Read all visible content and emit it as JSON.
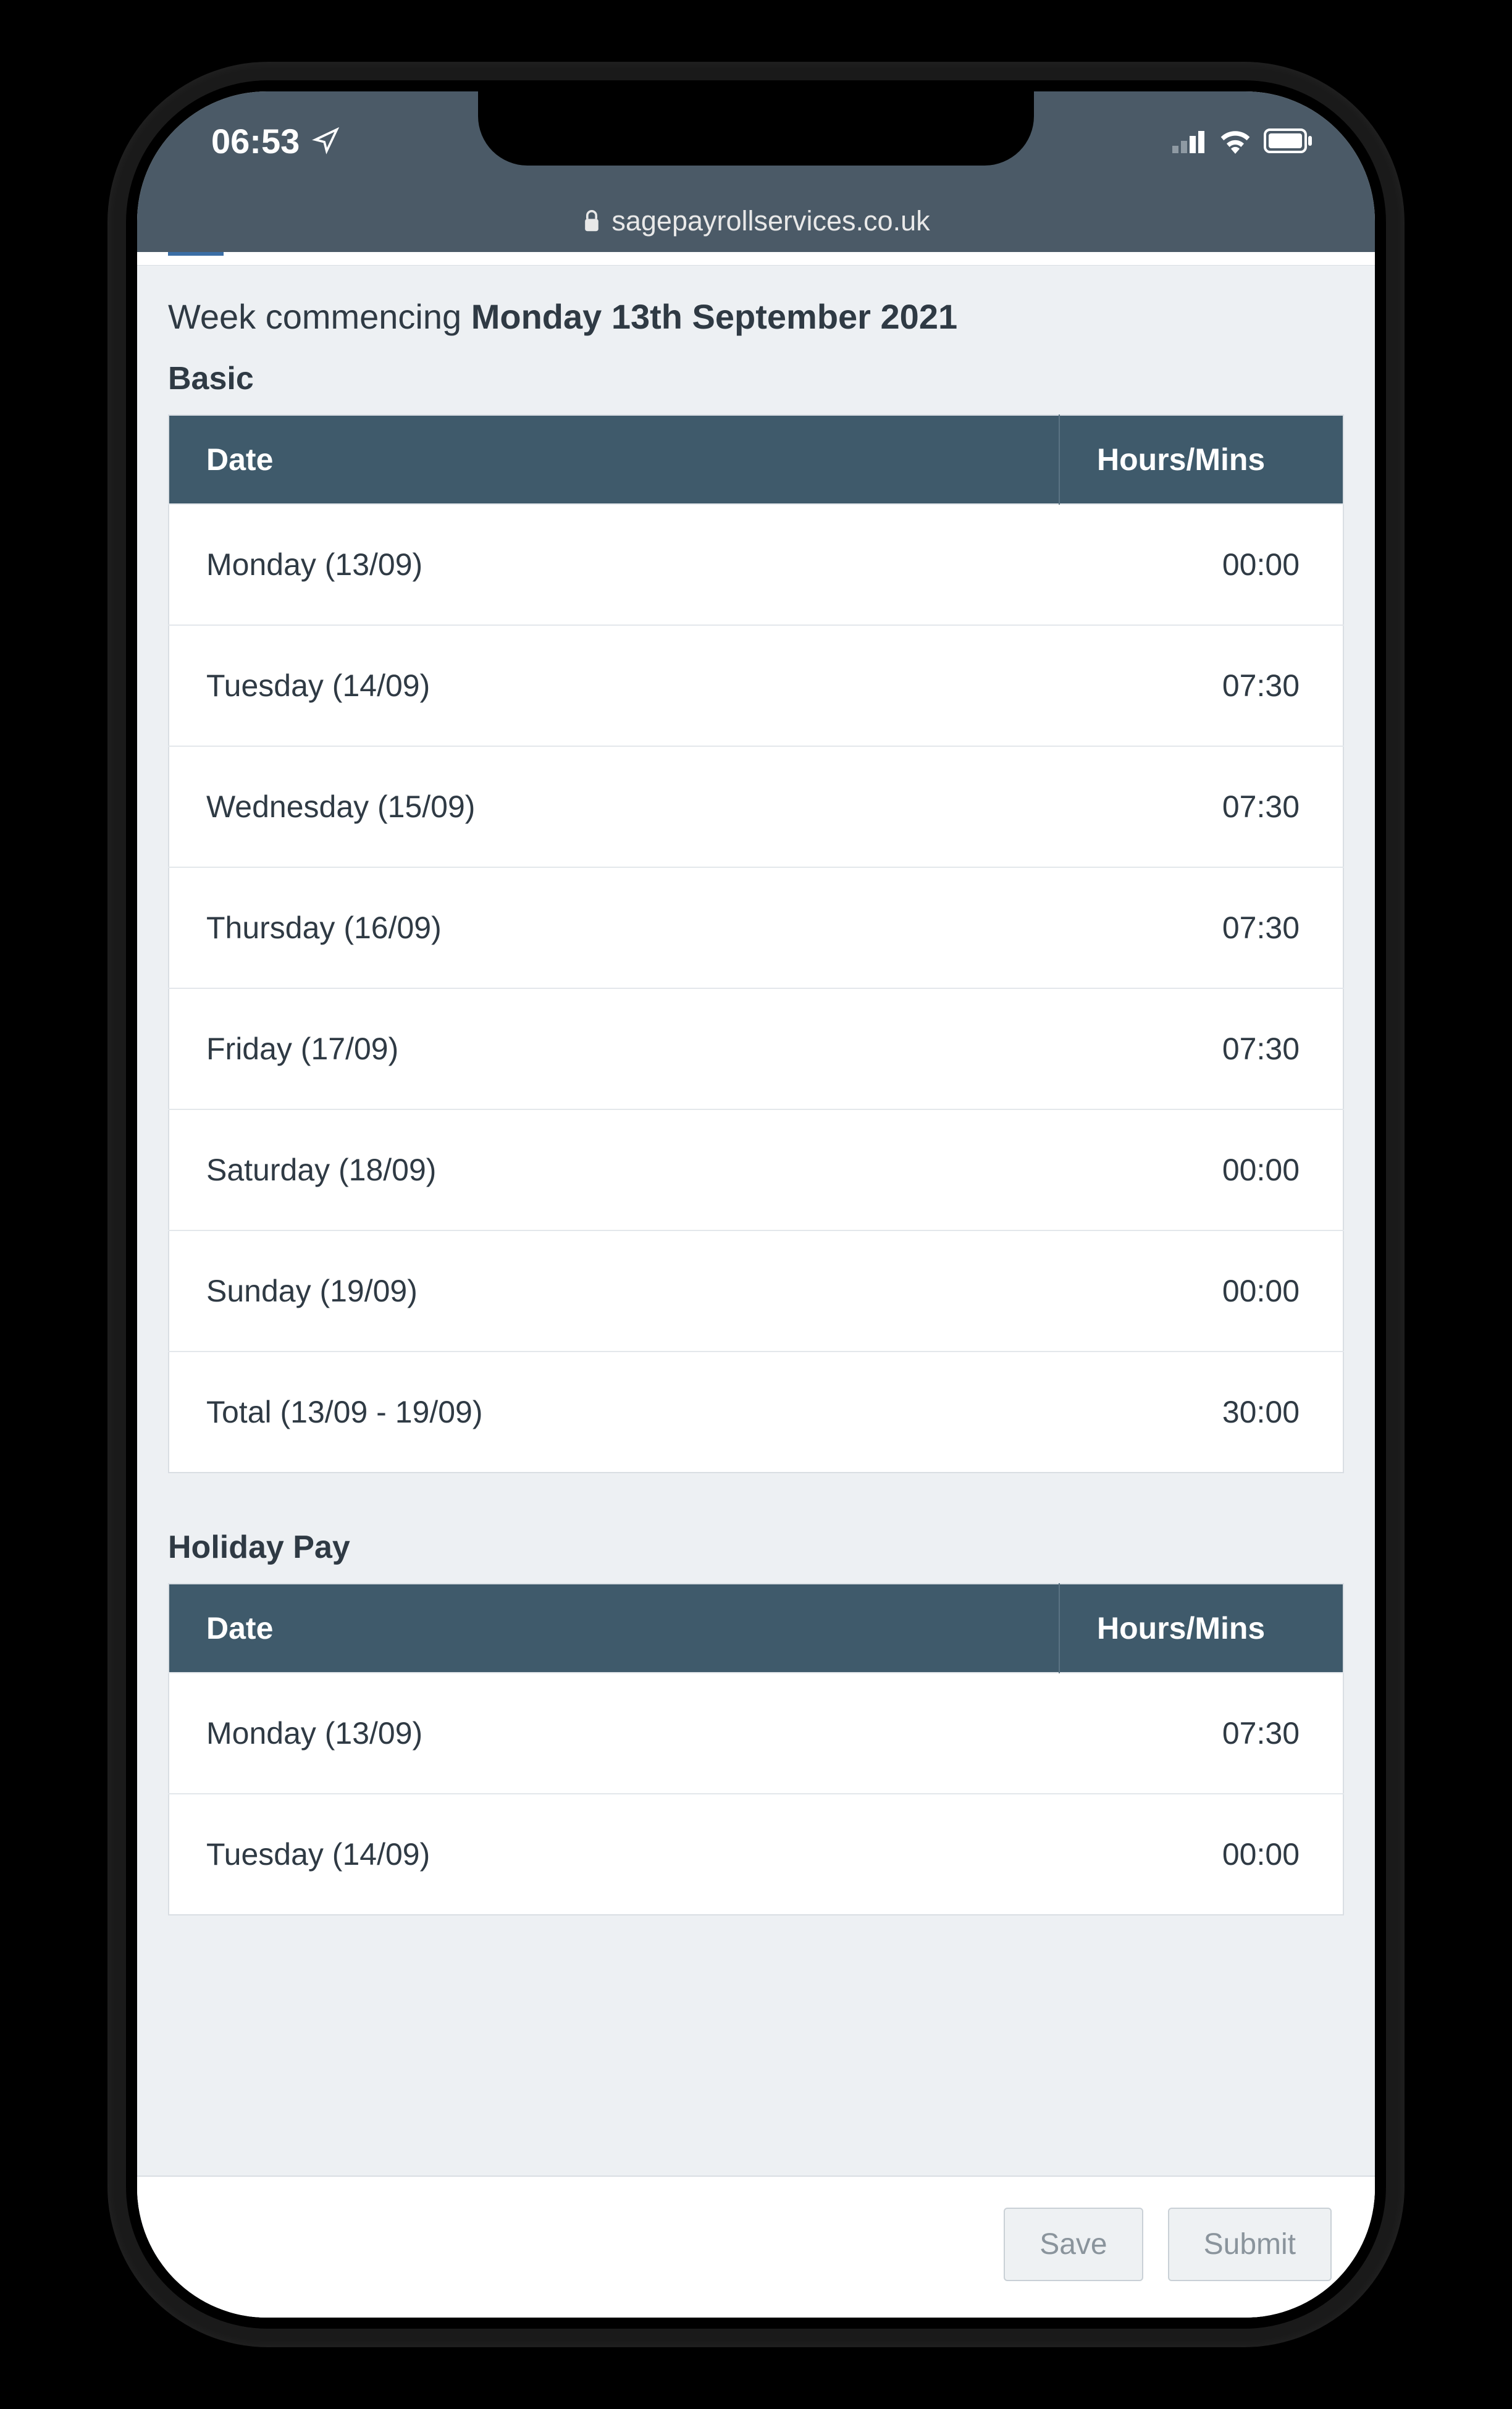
{
  "status": {
    "time": "06:53",
    "url": "sagepayrollservices.co.uk"
  },
  "heading": {
    "prefix": "Week commencing ",
    "date": "Monday 13th September 2021"
  },
  "sections": [
    {
      "title": "Basic",
      "headers": {
        "date": "Date",
        "hours": "Hours/Mins"
      },
      "rows": [
        {
          "label": "Monday (13/09)",
          "value": "00:00"
        },
        {
          "label": "Tuesday (14/09)",
          "value": "07:30"
        },
        {
          "label": "Wednesday (15/09)",
          "value": "07:30"
        },
        {
          "label": "Thursday (16/09)",
          "value": "07:30"
        },
        {
          "label": "Friday (17/09)",
          "value": "07:30"
        },
        {
          "label": "Saturday (18/09)",
          "value": "00:00"
        },
        {
          "label": "Sunday (19/09)",
          "value": "00:00"
        },
        {
          "label": "Total (13/09 - 19/09)",
          "value": "30:00"
        }
      ]
    },
    {
      "title": "Holiday Pay",
      "headers": {
        "date": "Date",
        "hours": "Hours/Mins"
      },
      "rows": [
        {
          "label": "Monday (13/09)",
          "value": "07:30"
        },
        {
          "label": "Tuesday (14/09)",
          "value": "00:00"
        }
      ]
    }
  ],
  "toolbar": {
    "save": "Save",
    "submit": "Submit"
  }
}
